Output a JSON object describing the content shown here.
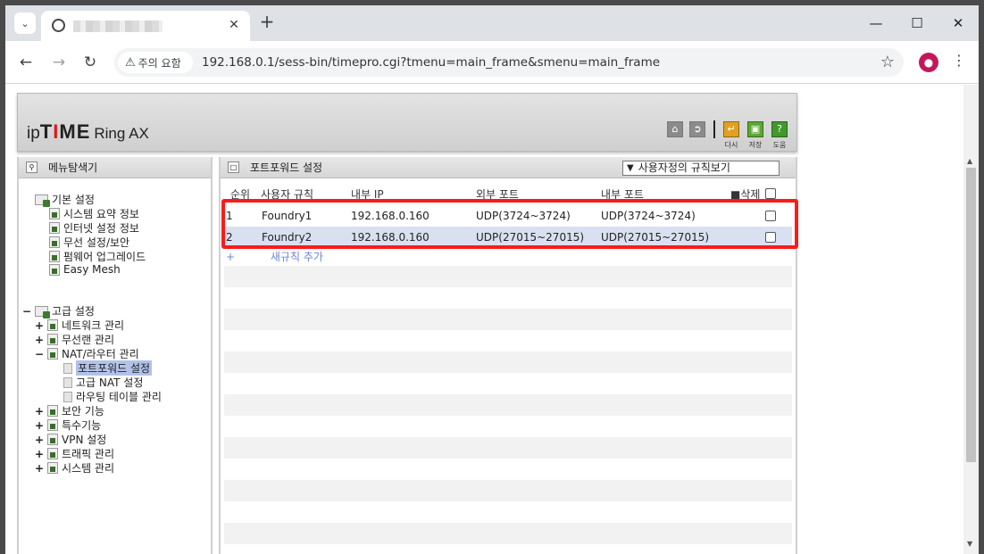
{
  "browser": {
    "tab_close": "✕",
    "new_tab": "+",
    "security_label": "주의 요함",
    "url": "192.168.0.1/sess-bin/timepro.cgi?tmenu=main_frame&smenu=main_frame",
    "window_controls": {
      "minimize": "—",
      "maximize": "☐",
      "close": "✕"
    }
  },
  "router": {
    "logo": {
      "ip": "ip",
      "time_a": "T",
      "time_i": "I",
      "time_b": "ME",
      "model": "Ring AX"
    },
    "toolbar": {
      "refresh_label": "다시",
      "save_label": "저장",
      "help_label": "도움"
    },
    "sidebar": {
      "title": "메뉴탐색기",
      "basic": {
        "label": "기본 설정",
        "items": [
          "시스템 요약 정보",
          "인터넷 설정 정보",
          "무선 설정/보안",
          "펌웨어 업그레이드",
          "Easy Mesh"
        ]
      },
      "advanced": {
        "label": "고급 설정",
        "network": "네트워크 관리",
        "wireless_lan": "무선랜 관리",
        "nat": "NAT/라우터 관리",
        "nat_children": [
          "포트포워드 설정",
          "고급 NAT 설정",
          "라우팅 테이블 관리"
        ],
        "rest": [
          "보안 기능",
          "특수기능",
          "VPN 설정",
          "트래픽 관리",
          "시스템 관리"
        ]
      }
    },
    "main": {
      "title": "포트포워드 설정",
      "view_select": "사용자정의 규칙보기",
      "columns": {
        "no": "순위",
        "rule": "사용자 규칙",
        "ip": "내부 IP",
        "ext_port": "외부 포트",
        "int_port": "내부 포트",
        "delete": "삭제"
      },
      "rows": [
        {
          "no": "1",
          "rule": "Foundry1",
          "ip": "192.168.0.160",
          "ext_port": "UDP(3724~3724)",
          "int_port": "UDP(3724~3724)"
        },
        {
          "no": "2",
          "rule": "Foundry2",
          "ip": "192.168.0.160",
          "ext_port": "UDP(27015~27015)",
          "int_port": "UDP(27015~27015)"
        }
      ],
      "add_rule_plus": "+",
      "add_rule": "새규칙 추가"
    }
  }
}
